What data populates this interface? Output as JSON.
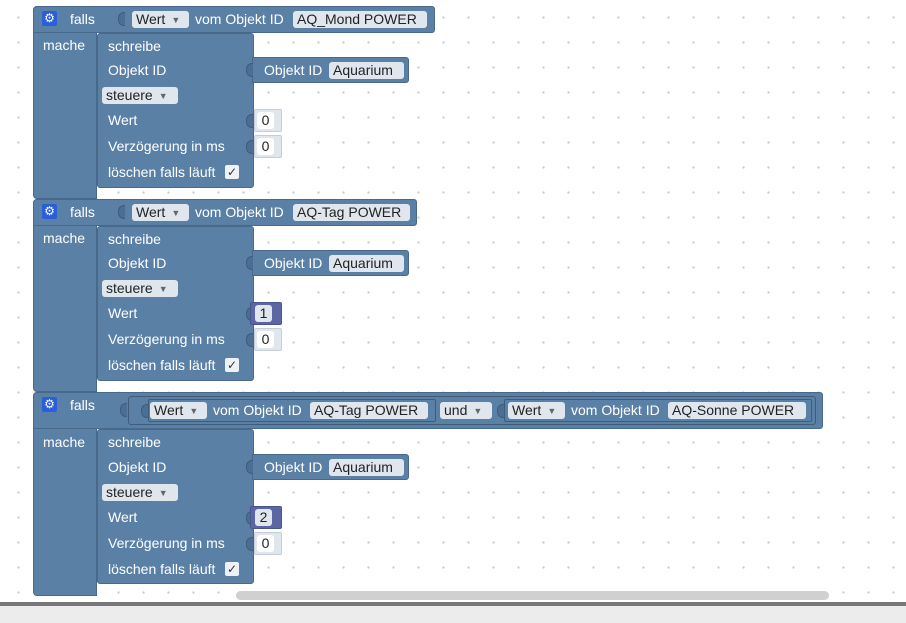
{
  "labels": {
    "falls": "falls",
    "mache": "mache",
    "schreibe": "schreibe",
    "objekt_id": "Objekt ID",
    "steuere": "steuere",
    "wert": "Wert",
    "verzoegerung": "Verzögerung in ms",
    "loeschen": "löschen falls läuft",
    "vom_objekt_id": "vom Objekt ID",
    "und": "und",
    "checkmark": "✓"
  },
  "icons": {
    "gear": "gear-icon",
    "check": "checkmark-icon",
    "dropdown": "▾"
  },
  "blocks": [
    {
      "condition_value": "Wert",
      "condition_object": "AQ_Mond POWER",
      "target_object": "Aquarium",
      "mode": "steuere",
      "value": "0",
      "value_style": "light",
      "delay": "0"
    },
    {
      "condition_value": "Wert",
      "condition_object": "AQ-Tag POWER",
      "target_object": "Aquarium",
      "mode": "steuere",
      "value": "1",
      "value_style": "dark",
      "delay": "0"
    },
    {
      "condition_value": "Wert",
      "condition_object": "AQ-Tag POWER",
      "operator": "und",
      "condition2_value": "Wert",
      "condition2_object": "AQ-Sonne POWER",
      "target_object": "Aquarium",
      "mode": "steuere",
      "value": "2",
      "value_style": "dark",
      "delay": "0"
    }
  ],
  "colors": {
    "logic": "#5b80a5",
    "number": "#5b67a5",
    "gear": "#2a5fd9"
  }
}
